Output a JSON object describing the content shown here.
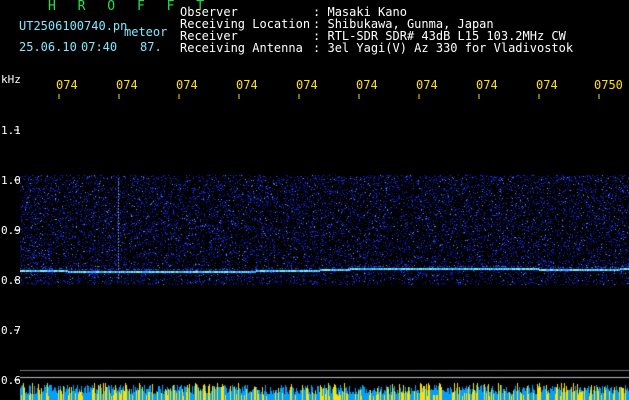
{
  "header": {
    "brand": "H R O F F T",
    "filename": "UT2506100740.pn",
    "meteor_label": "meteor",
    "date": "25.06.10",
    "time": "07:40",
    "count": "87.",
    "info": [
      {
        "label": "Observer",
        "sep": ":",
        "value": "Masaki Kano"
      },
      {
        "label": "Receiving Location",
        "sep": ":",
        "value": "Shibukawa, Gunma, Japan"
      },
      {
        "label": "Receiver",
        "sep": ":",
        "value": "RTL-SDR SDR# 43dB L15 103.2MHz CW"
      },
      {
        "label": "Receiving Antenna",
        "sep": ":",
        "value": "3el Yagi(V) Az 330 for Vladivostok"
      }
    ]
  },
  "axis": {
    "unit": "kHz",
    "time_labels": [
      "074",
      "074",
      "074",
      "074",
      "074",
      "074",
      "074",
      "074",
      "074",
      "0750"
    ],
    "freq_labels": [
      "1.1",
      "1.0",
      "0.9",
      "0.8",
      "0.7",
      "0.6"
    ]
  },
  "colors": {
    "header_green": "#22e04a",
    "time_yellow": "#ffe000",
    "noise_blue": "#1830ff",
    "signal_cyan": "#80f0ff",
    "bottom_yellow": "#ffe000"
  }
}
